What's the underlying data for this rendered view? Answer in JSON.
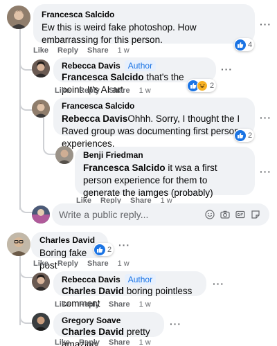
{
  "comments": [
    {
      "author": "Francesca Salcido",
      "text": "Ew this is weird fake photoshop. How embarrassing for this person.",
      "actions": {
        "like": "Like",
        "reply": "Reply",
        "share": "Share",
        "time": "1 w"
      },
      "reactions": {
        "types": [
          "like"
        ],
        "count": "4"
      },
      "replies": [
        {
          "author": "Rebecca Davis",
          "badge": "Author",
          "mention": "Francesca Salcido",
          "text": "that's the point. It's AI art",
          "actions": {
            "like": "Like",
            "reply": "Reply",
            "share": "Share",
            "time": "1 w"
          },
          "reactions": {
            "types": [
              "like",
              "haha"
            ],
            "count": "2"
          }
        },
        {
          "author": "Francesca Salcido",
          "mention": "Rebecca Davis",
          "text": "Ohhh. Sorry, I thought the I Raved group was documenting first person experiences.",
          "actions": {
            "like": "Like",
            "reply": "Reply",
            "share": "Share",
            "time": "1 w"
          },
          "reactions": {
            "types": [
              "like"
            ],
            "count": "2"
          }
        },
        {
          "author": "Benji Friedman",
          "mention": "Francesca Salcido",
          "text": "it wsa a first person experience for them to generate the iamges (probably)",
          "actions": {
            "like": "Like",
            "reply": "Reply",
            "share": "Share",
            "time": "1 w"
          }
        }
      ],
      "reply_box": {
        "placeholder": "Write a public reply..."
      }
    },
    {
      "author": "Charles David",
      "text": "Boring fake post",
      "actions": {
        "like": "Like",
        "reply": "Reply",
        "share": "Share",
        "time": "1 w"
      },
      "reactions": {
        "types": [
          "like"
        ],
        "count": "2"
      },
      "replies": [
        {
          "author": "Rebecca Davis",
          "badge": "Author",
          "mention": "Charles David",
          "text": "boring pointless comment",
          "actions": {
            "like": "Like",
            "reply": "Reply",
            "share": "Share",
            "time": "1 w"
          }
        },
        {
          "author": "Gregory Soave",
          "mention": "Charles David",
          "text": "pretty amazing",
          "actions": {
            "like": "Like",
            "reply": "Reply",
            "share": "Share",
            "time": "1 w"
          }
        }
      ]
    }
  ],
  "more_label": "···",
  "icons": [
    "like-icon",
    "haha-icon",
    "emoji-icon",
    "camera-icon",
    "gif-icon",
    "sticker-icon",
    "more-options-icon"
  ],
  "colors": {
    "accent": "#1b74e4",
    "bubble": "#f0f2f5",
    "secondary_text": "#65676b",
    "haha": "#f7b125"
  }
}
